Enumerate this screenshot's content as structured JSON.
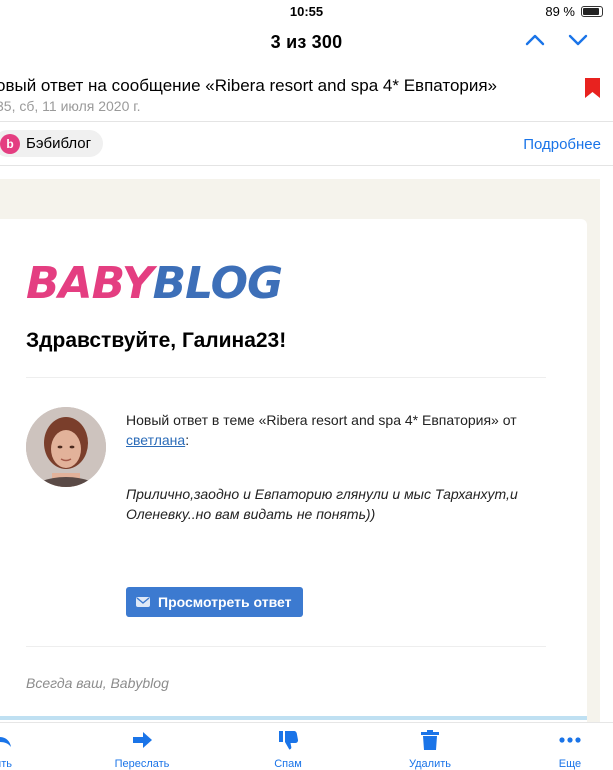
{
  "status": {
    "time": "10:55",
    "battery": "89 %"
  },
  "nav": {
    "title": "3 из 300",
    "up_icon": "chevron-up-icon",
    "down_icon": "chevron-down-icon"
  },
  "message": {
    "subject": "овый ответ на сообщение «Ribera resort and spa 4* Евпатория»",
    "meta": "35, сб, 11 июля 2020 г.",
    "flag_color": "#e8221f"
  },
  "sender": {
    "initial": "b",
    "name": "Бэбиблог",
    "details_label": "Подробнее"
  },
  "email": {
    "logo_text": "BABYBLOG",
    "greeting": "Здравствуйте, Галина23!",
    "notice_text": "Новый ответ в теме «Ribera resort and spa 4* Евпатория» от",
    "author_name": "светлана",
    "colon": ":",
    "quote": "Прилично,заодно и Евпаторию глянули и мыс Тарханхут,и Оленевку..но вам видать не понять))",
    "button_label": "Просмотреть ответ",
    "signature": "Всегда ваш, Babyblog"
  },
  "toolbar": {
    "reply_label": "тить",
    "forward_label": "Переслать",
    "spam_label": "Спам",
    "delete_label": "Удалить",
    "more_label": "Еще"
  },
  "colors": {
    "accent": "#1a74e8",
    "logo_pink": "#e43e81",
    "logo_blue": "#3d6fb8",
    "button": "#3c7ad0"
  }
}
